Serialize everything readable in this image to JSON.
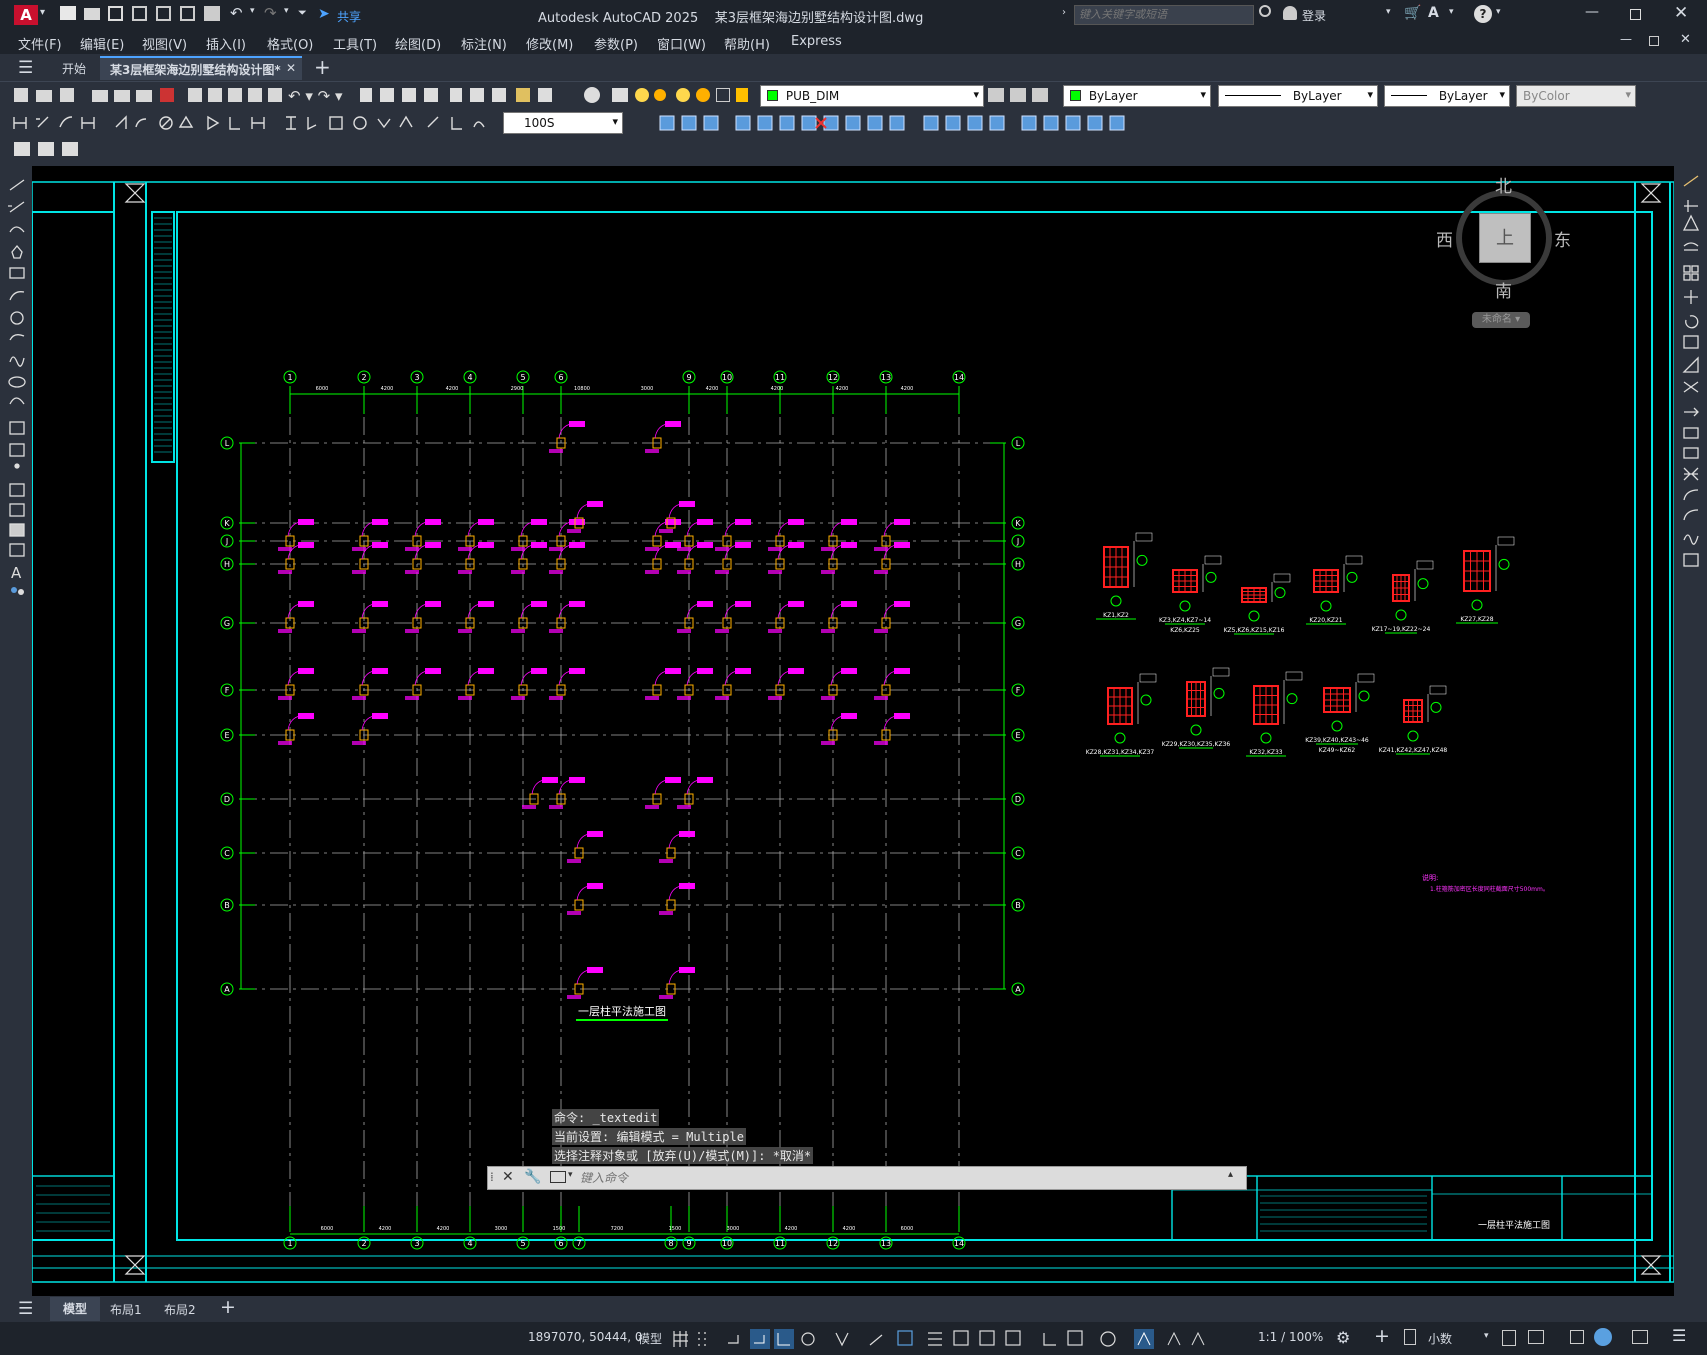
{
  "titlebar": {
    "app_logo": "A",
    "share": "共享",
    "title": "Autodesk AutoCAD 2025    某3层框架海边别墅结构设计图.dwg",
    "search_placeholder": "键入关键字或短语",
    "login": "登录"
  },
  "menu": {
    "items": [
      "文件(F)",
      "编辑(E)",
      "视图(V)",
      "插入(I)",
      "格式(O)",
      "工具(T)",
      "绘图(D)",
      "标注(N)",
      "修改(M)",
      "参数(P)",
      "窗口(W)",
      "帮助(H)",
      "Express"
    ]
  },
  "doc_tabs": {
    "start": "开始",
    "active": "某3层框架海边别墅结构设计图*"
  },
  "props": {
    "layer": "PUB_DIM",
    "color": "ByLayer",
    "linetype": "ByLayer",
    "lineweight": "ByLayer",
    "plotstyle": "ByColor",
    "dimstyle": "100S"
  },
  "viewcube": {
    "north": "北",
    "south": "南",
    "east": "东",
    "west": "西",
    "face": "上",
    "ucs": "未命名"
  },
  "drawing": {
    "title": "一层柱平法施工图",
    "grid_top": [
      "1",
      "2",
      "3",
      "4",
      "5",
      "6",
      "9",
      "10",
      "11",
      "12",
      "13",
      "14"
    ],
    "grid_bottom": [
      "1",
      "2",
      "3",
      "4",
      "5",
      "6",
      "7",
      "8",
      "9",
      "10",
      "11",
      "12",
      "13",
      "14"
    ],
    "grid_rows": [
      "L",
      "K",
      "J",
      "H",
      "G",
      "F",
      "E",
      "D",
      "C",
      "B",
      "A"
    ],
    "dims_top": [
      "6000",
      "4200",
      "4200",
      "2900",
      "10800",
      "3000",
      "4200",
      "4200",
      "4200",
      "4200"
    ],
    "dims_bottom": [
      "6000",
      "4200",
      "4200",
      "3000",
      "1500",
      "7200",
      "1500",
      "3000",
      "4200",
      "4200",
      "6000"
    ],
    "section_labels_row1": [
      "KZ1,KZ2",
      "KZ3,KZ4,KZ7~14",
      "KZ5,KZ6,KZ15,KZ16",
      "KZ20,KZ21",
      "KZ17~19,KZ22~24",
      "KZ27,KZ28"
    ],
    "section_sub": "KZ6,KZ25",
    "section_labels_row2": [
      "KZ28,KZ31,KZ34,KZ37",
      "KZ29,KZ30,KZ35,KZ36",
      "KZ32,KZ33",
      "KZ39,KZ40,KZ43~46",
      "KZ41,KZ42,KZ47,KZ48"
    ],
    "section_sub2": "KZ49~KZ62",
    "note_title": "说明:",
    "note_text": "1.柱箍筋加密区长度同柱截面尺寸500mm。",
    "titleblock_name": "一层柱平法施工图"
  },
  "command": {
    "line1": "命令: _textedit",
    "line2": "当前设置: 编辑模式 = Multiple",
    "line3": "选择注释对象或 [放弃(U)/模式(M)]: *取消*",
    "placeholder": "键入命令"
  },
  "layout_tabs": [
    "模型",
    "布局1",
    "布局2"
  ],
  "status": {
    "coords": "1897070, 50444, 0",
    "model": "模型",
    "scale": "1:1 / 100%",
    "units": "小数"
  },
  "colors": {
    "grid": "#00ff00",
    "border": "#00e5e5",
    "column": "#ff00ff",
    "rebar": "#ff2020"
  }
}
